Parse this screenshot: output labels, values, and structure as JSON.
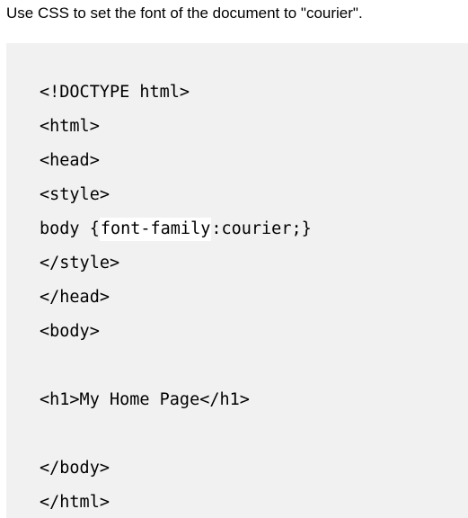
{
  "instruction": "Use CSS to set the font of the document to \"courier\".",
  "code": {
    "doctype": "<!DOCTYPE html>",
    "html_open": "<html>",
    "head_open": "<head>",
    "style_open": "<style>",
    "body_rule_prefix": "body {",
    "answer_value": "font-family",
    "body_rule_suffix": ":courier;}",
    "style_close": "</style>",
    "head_close": "</head>",
    "body_open": "<body>",
    "h1_line": "<h1>My Home Page</h1>",
    "body_close": "</body>",
    "html_close": "</html>"
  },
  "colors": {
    "panel_background": "#f1f1f1",
    "input_background": "#ffffff"
  }
}
